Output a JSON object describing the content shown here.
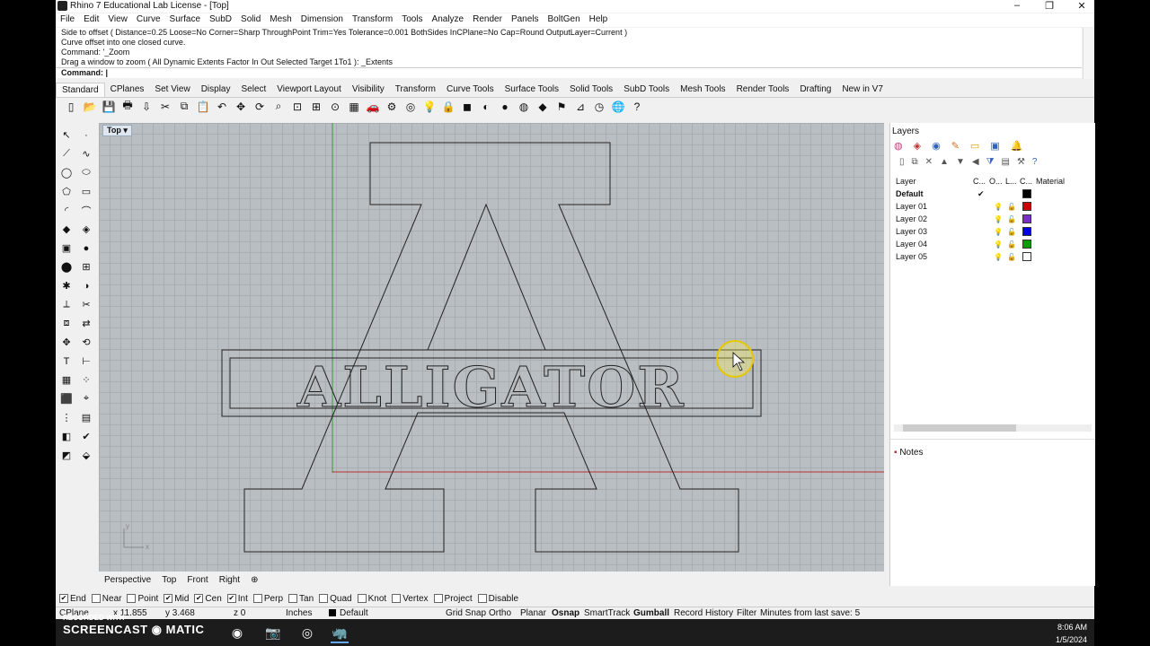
{
  "window": {
    "title": "Rhino 7 Educational Lab License - [Top]",
    "minimize": "–",
    "restore": "❐",
    "close": "✕"
  },
  "menu": [
    "File",
    "Edit",
    "View",
    "Curve",
    "Surface",
    "SubD",
    "Solid",
    "Mesh",
    "Dimension",
    "Transform",
    "Tools",
    "Analyze",
    "Render",
    "Panels",
    "BoltGen",
    "Help"
  ],
  "command_history": [
    "Side to offset ( Distance=0.25  Loose=No  Corner=Sharp  ThroughPoint  Trim=Yes  Tolerance=0.001  BothSides  InCPlane=No  Cap=Round  OutputLayer=Current )",
    "Curve offset into one closed curve.",
    "Command: '_Zoom",
    "Drag a window to zoom ( All  Dynamic  Extents  Factor  In  Out  Selected  Target  1To1 ): _Extents"
  ],
  "command_prompt": "Command:",
  "toolbar_tabs": [
    "Standard",
    "CPlanes",
    "Set View",
    "Display",
    "Select",
    "Viewport Layout",
    "Visibility",
    "Transform",
    "Curve Tools",
    "Surface Tools",
    "Solid Tools",
    "SubD Tools",
    "Mesh Tools",
    "Render Tools",
    "Drafting",
    "New in V7"
  ],
  "active_tab": "Standard",
  "toolbar_icons": [
    "new-icon",
    "open-icon",
    "save-icon",
    "print-icon",
    "import-icon",
    "cut-icon",
    "copy-icon",
    "paste-icon",
    "undo-icon",
    "pan-icon",
    "rotate-view-icon",
    "zoom-icon",
    "zoom-extents-icon",
    "zoom-window-icon",
    "zoom-selected-icon",
    "grid-icon",
    "car-icon",
    "properties-icon",
    "object-snap-icon",
    "light-icon",
    "lock-icon",
    "layer-icon",
    "color-wheel-icon",
    "shade-icon",
    "render-icon",
    "material-icon",
    "flag-icon",
    "dimension-icon",
    "align-icon",
    "globe-icon",
    "help-icon"
  ],
  "viewport": {
    "title": "Top",
    "arrow": "▾",
    "lettering": "ALLIGATOR",
    "axis_y": "y",
    "axis_x": "x"
  },
  "viewport_tabs": [
    "Perspective",
    "Top",
    "Front",
    "Right"
  ],
  "viewport_add": "⊕",
  "layers_panel": {
    "title": "Layers",
    "columns": [
      "Layer",
      "C...",
      "O...",
      "L...",
      "C...",
      "Material"
    ],
    "layers": [
      {
        "name": "Default",
        "current": true,
        "color": "#000000"
      },
      {
        "name": "Layer 01",
        "current": false,
        "color": "#d10000"
      },
      {
        "name": "Layer 02",
        "current": false,
        "color": "#7a2fc9"
      },
      {
        "name": "Layer 03",
        "current": false,
        "color": "#0000e0"
      },
      {
        "name": "Layer 04",
        "current": false,
        "color": "#00a000"
      },
      {
        "name": "Layer 05",
        "current": false,
        "color": "#ffffff"
      }
    ]
  },
  "notes_panel": {
    "title": "Notes"
  },
  "osnaps": [
    {
      "label": "End",
      "checked": true
    },
    {
      "label": "Near",
      "checked": false
    },
    {
      "label": "Point",
      "checked": false
    },
    {
      "label": "Mid",
      "checked": true
    },
    {
      "label": "Cen",
      "checked": true
    },
    {
      "label": "Int",
      "checked": true
    },
    {
      "label": "Perp",
      "checked": false
    },
    {
      "label": "Tan",
      "checked": false
    },
    {
      "label": "Quad",
      "checked": false
    },
    {
      "label": "Knot",
      "checked": false
    },
    {
      "label": "Vertex",
      "checked": false
    },
    {
      "label": "Project",
      "checked": false
    },
    {
      "label": "Disable",
      "checked": false
    }
  ],
  "status": {
    "cplane": "CPlane",
    "x": "x 11.855",
    "y": "y 3.468",
    "z": "z 0",
    "units": "Inches",
    "layer": "Default",
    "grid_snap": "Grid Snap",
    "ortho": "Ortho",
    "planar": "Planar",
    "osnap": "Osnap",
    "smarttrack": "SmartTrack",
    "gumball": "Gumball",
    "record_history": "Record History",
    "filter": "Filter",
    "save_info": "Minutes from last save: 5"
  },
  "taskbar": {
    "time": "8:06 AM",
    "date": "1/5/2024",
    "watermark": "RECORDED WITH",
    "brand": "SCREENCAST ◉ MATIC"
  },
  "colors": {
    "accent": "#1e5aa8",
    "x_axis": "#c03030",
    "y_axis": "#30a030"
  }
}
